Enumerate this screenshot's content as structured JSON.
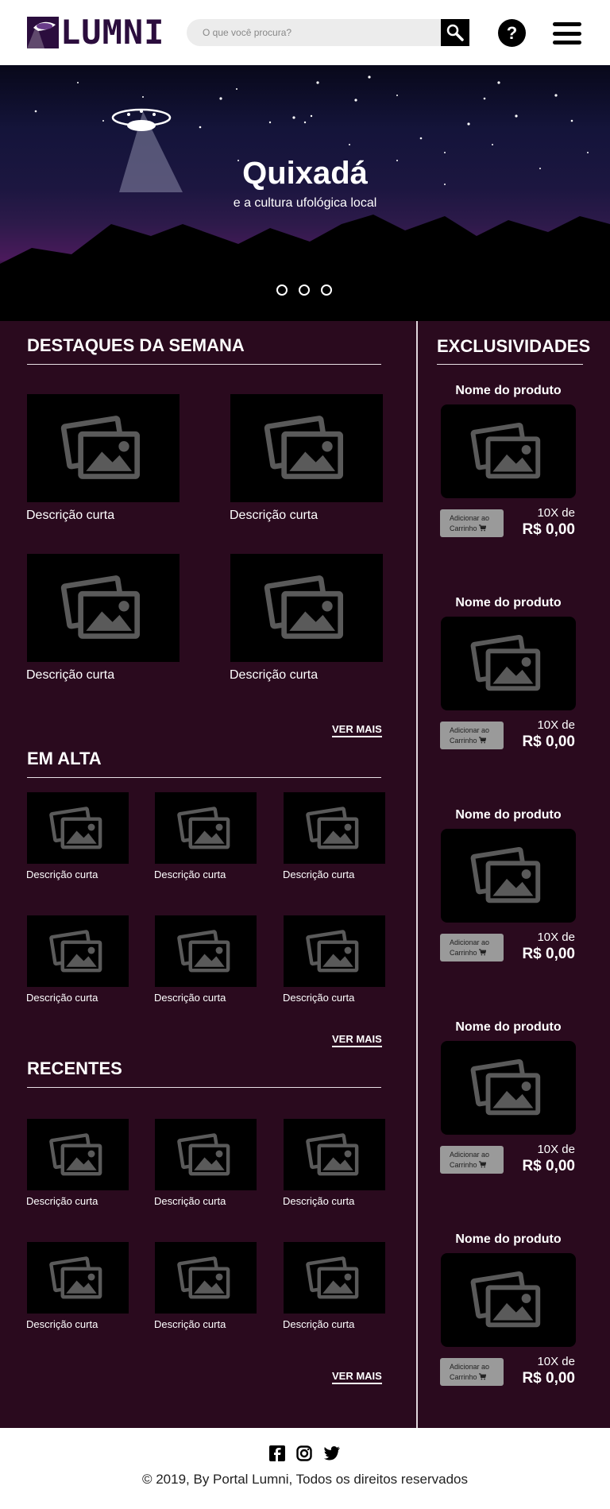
{
  "header": {
    "logo_text": "LUMNI",
    "search_placeholder": "O que você procura?",
    "help_label": "?"
  },
  "hero": {
    "title": "Quixadá",
    "subtitle": "e a cultura ufológica local",
    "slides": 3
  },
  "destaques": {
    "title": "DESTAQUES DA SEMANA",
    "items": [
      {
        "caption": "Descrição curta"
      },
      {
        "caption": "Descrição curta"
      },
      {
        "caption": "Descrição curta"
      },
      {
        "caption": "Descrição curta"
      }
    ],
    "ver_mais": "VER MAIS"
  },
  "em_alta": {
    "title": "EM ALTA",
    "items": [
      {
        "caption": "Descrição curta"
      },
      {
        "caption": "Descrição curta"
      },
      {
        "caption": "Descrição curta"
      },
      {
        "caption": "Descrição curta"
      },
      {
        "caption": "Descrição curta"
      },
      {
        "caption": "Descrição curta"
      }
    ],
    "ver_mais": "VER MAIS"
  },
  "recentes": {
    "title": "RECENTES",
    "items": [
      {
        "caption": "Descrição curta"
      },
      {
        "caption": "Descrição curta"
      },
      {
        "caption": "Descrição curta"
      },
      {
        "caption": "Descrição curta"
      },
      {
        "caption": "Descrição curta"
      },
      {
        "caption": "Descrição curta"
      }
    ],
    "ver_mais": "VER MAIS"
  },
  "exclusividades": {
    "title": "EXCLUSIVIDADES",
    "products": [
      {
        "name": "Nome do produto",
        "cart_label_1": "Adicionar ao",
        "cart_label_2": "Carrinho",
        "installments": "10X de",
        "price": "R$ 0,00"
      },
      {
        "name": "Nome do produto",
        "cart_label_1": "Adicionar ao",
        "cart_label_2": "Carrinho",
        "installments": "10X de",
        "price": "R$ 0,00"
      },
      {
        "name": "Nome do produto",
        "cart_label_1": "Adicionar ao",
        "cart_label_2": "Carrinho",
        "installments": "10X de",
        "price": "R$ 0,00"
      },
      {
        "name": "Nome do produto",
        "cart_label_1": "Adicionar ao",
        "cart_label_2": "Carrinho",
        "installments": "10X de",
        "price": "R$ 0,00"
      },
      {
        "name": "Nome do produto",
        "cart_label_1": "Adicionar ao",
        "cart_label_2": "Carrinho",
        "installments": "10X de",
        "price": "R$ 0,00"
      }
    ]
  },
  "footer": {
    "social": [
      "facebook-icon",
      "instagram-icon",
      "twitter-icon"
    ],
    "copyright": "©  2019, By Portal Lumni, Todos os direitos reservados"
  },
  "colors": {
    "background": "#2a0a1e",
    "logo": "#2b0d3d",
    "placeholder_icon": "#5a5a5a"
  }
}
